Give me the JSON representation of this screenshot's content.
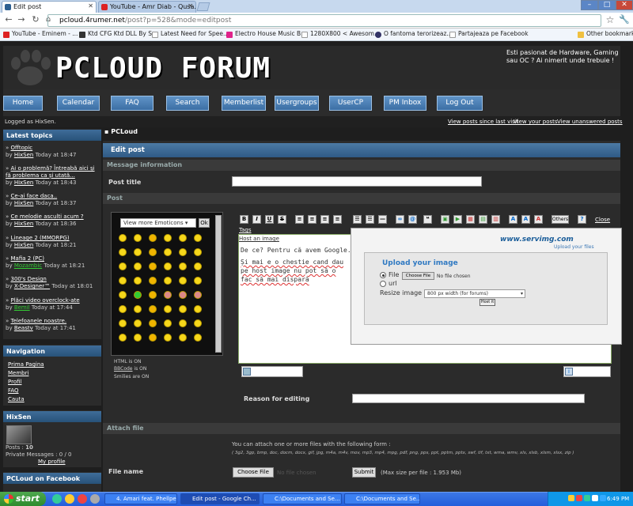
{
  "browser": {
    "tabs": [
      {
        "label": "Edit post",
        "active": true
      },
      {
        "label": "YouTube - Amr Diab - Qusa...",
        "active": false
      }
    ],
    "url_host": "pcloud.4rumer.net",
    "url_path": "/post?p=528&mode=editpost",
    "bookmarks": [
      "YouTube - Eminem - ...",
      "Ktd CFG Ktd DLL By S...",
      "Latest Need for Spee...",
      "Electro House Music B...",
      "1280X800 < Awesom...",
      "O fantoma terorizeaz...",
      "Partajeaza pe Facebook",
      "Other bookmarks"
    ]
  },
  "forum": {
    "logo": "PCLOUD FORUM",
    "tagline": "Esti pasionat de Hardware, Gaming sau OC ? Ai nimerit unde trebuie !",
    "nav": [
      "Home",
      "Calendar",
      "FAQ",
      "Search",
      "Memberlist",
      "Usergroups",
      "UserCP",
      "PM Inbox",
      "Log Out"
    ],
    "logged_in": "Logged as HixSen.",
    "top_links": [
      "View posts since last visit",
      "View your posts",
      "View unanswered posts"
    ],
    "sidebar": {
      "latest_title": "Latest topics",
      "topics": [
        {
          "title": "Offtopic",
          "by": "HixSen",
          "time": "Today at 18:47"
        },
        {
          "title": "Ai o problemă? Întreabă aici şi fă problema ca și utată...",
          "by": "HixSen",
          "time": "Today at 18:43"
        },
        {
          "title": "Ce-ai face daca..",
          "by": "HixSen",
          "time": "Today at 18:37"
        },
        {
          "title": "Ce melodie asculti acum ?",
          "by": "HixSen",
          "time": "Today at 18:36"
        },
        {
          "title": "Lineage 2 (MMORPG)",
          "by": "HixSen",
          "time": "Today at 18:21"
        },
        {
          "title": "Mafia 2 (PC)",
          "by": "Mozambic",
          "time": "Today at 18:21"
        },
        {
          "title": "300's Design",
          "by": "X-Designer™",
          "time": "Today at 18:01"
        },
        {
          "title": "Plăci video overclock-ate",
          "by": "Bemil",
          "time": "Today at 17:44"
        },
        {
          "title": "Telefoanele noastre.",
          "by": "Beastv",
          "time": "Today at 17:41"
        }
      ],
      "navigation_title": "Navigation",
      "navigation": [
        "Prima Pagina",
        "Membri",
        "Profil",
        "FAQ",
        "Cauta"
      ],
      "user_title": "HixSen",
      "posts_label": "Posts :",
      "posts_value": "10",
      "pm_label": "Private Messages :",
      "pm_value": "0 / 0",
      "my_profile": "My profile",
      "facebook_title": "PCLoud on Facebook"
    },
    "main": {
      "breadcrumb": "PCLoud",
      "edit_title": "Edit post",
      "msg_info": "Message information",
      "post_title_label": "Post title",
      "post_label": "Post",
      "emoticon_select": "View more Emoticons",
      "ok": "Ok",
      "html_on": "HTML is ON",
      "bbcode": "BBCode",
      "bbcode_suffix": "is ON",
      "smilies": "Smilies are ON",
      "tags": "Tags",
      "host_image": "Host an image",
      "others": "Others",
      "close": "Close",
      "text_line1": "De ce? Pentru că avem Google...",
      "text_line2": "Și mai e o chestie cand dau",
      "text_line3": "pe host image nu pot să o",
      "text_line4": "fac să mai dispară",
      "reason_label": "Reason for editing",
      "attach_title": "Attach file",
      "attach_text": "You can attach one or more files with the following form :",
      "attach_types": "( 3g2, 3gp, bmp, doc, docm, docx, gif, jpg, m4a, m4v, mov, mp3, mp4, mpg, pdf, png, pps, ppt, pptm, pptx, swf, tif, txt, wma, wmv, xls, xlsb, xlsm, xlsx, zip )",
      "file_name_label": "File name",
      "choose_file": "Choose File",
      "no_file": "No file chosen",
      "submit": "Submit",
      "max_size": "(Max size per file : 1.953 Mb)"
    },
    "popup": {
      "brand": "www.servimg.com",
      "brand_sub": "Upload your files",
      "title": "Upload your image",
      "file_opt": "File",
      "choose": "Choose File",
      "no_file": "No file chosen",
      "url_opt": "url",
      "resize_label": "Resize image",
      "resize_value": "800 px width (for forums)",
      "host_btn": "Host it"
    }
  },
  "taskbar": {
    "start": "start",
    "tasks": [
      {
        "label": "4. Amari feat. Phellpe...",
        "active": false
      },
      {
        "label": "Edit post - Google Ch...",
        "active": true
      },
      {
        "label": "C:\\Documents and Se...",
        "active": false
      },
      {
        "label": "C:\\Documents and Se...",
        "active": false
      }
    ],
    "lang": "RO",
    "time": "6:49 PM"
  }
}
